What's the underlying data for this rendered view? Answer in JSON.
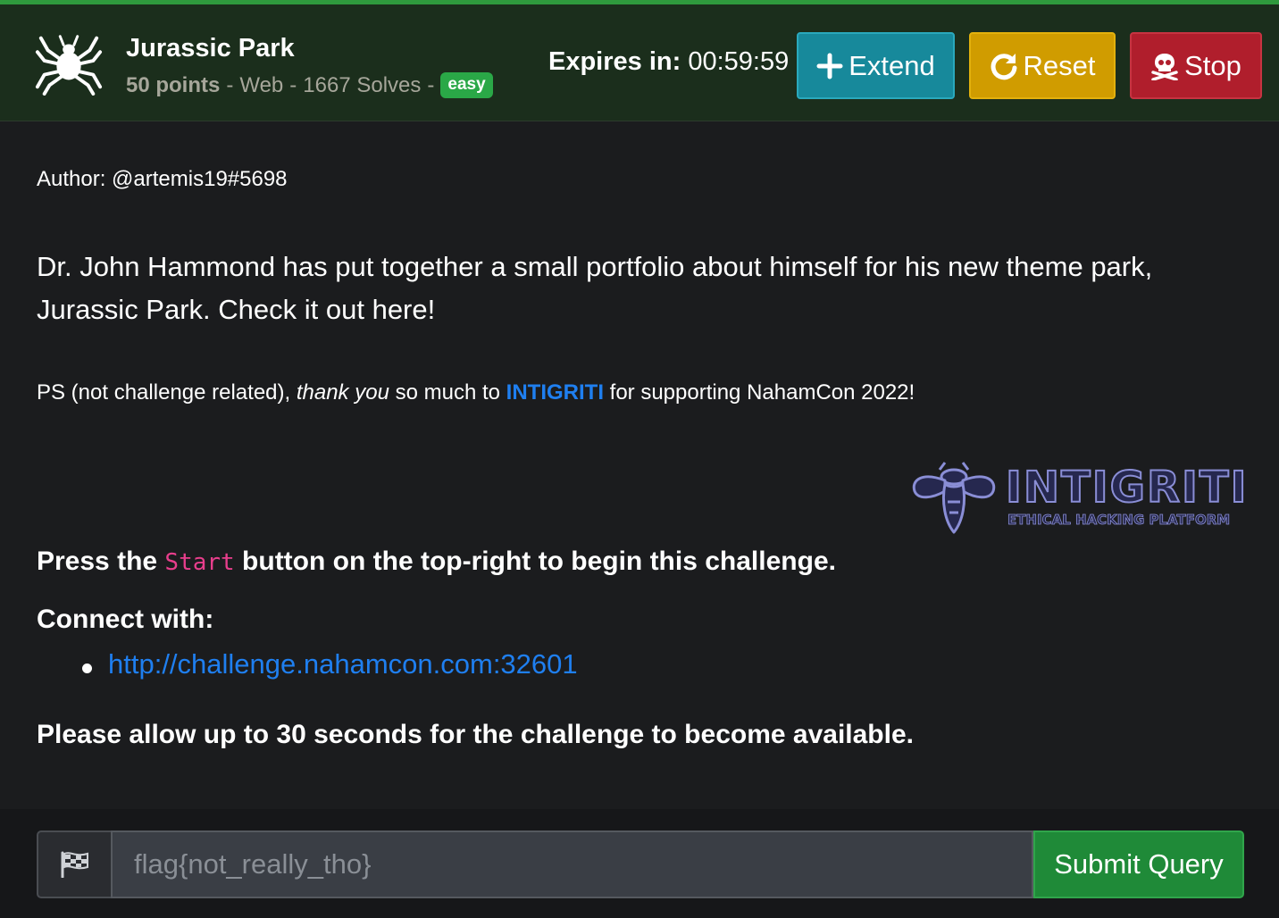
{
  "header": {
    "icon": "spider-icon",
    "title": "Jurassic Park",
    "points": "50 points",
    "category": "Web",
    "solves": "1667 Solves",
    "separator": "-",
    "difficulty": "easy",
    "expires_label": "Expires in",
    "expires_colon": ":",
    "expires_value": "00:59:59",
    "buttons": {
      "extend": {
        "label": "Extend",
        "icon": "plus-icon"
      },
      "reset": {
        "label": "Reset",
        "icon": "redo-icon"
      },
      "stop": {
        "label": "Stop",
        "icon": "skull-crossbones-icon"
      }
    }
  },
  "body": {
    "author": "Author: @artemis19#5698",
    "description": "Dr. John Hammond has put together a small portfolio about himself for his new theme park, Jurassic Park. Check it out here!",
    "ps": {
      "prefix": "PS (not challenge related), ",
      "emphasis": "thank you",
      "middle": " so much to ",
      "brand": "INTIGRITI",
      "suffix": " for supporting NahamCon 2022!"
    },
    "sponsor_logo": {
      "wordmark": "INTIGRITI",
      "tagline": "ETHICAL HACKING PLATFORM"
    },
    "press": {
      "before": "Press the ",
      "code": "Start",
      "after": " button on the top-right to begin this challenge."
    },
    "connect_heading": "Connect with:",
    "connect_links": [
      "http://challenge.nahamcon.com:32601"
    ],
    "allow_note": "Please allow up to 30 seconds for the challenge to become available."
  },
  "flag_form": {
    "icon": "checkered-flag-icon",
    "input_value": "",
    "placeholder": "flag{not_really_tho}",
    "submit_label": "Submit Query"
  },
  "colors": {
    "header_bg": "#1b2e1c",
    "header_accent": "#2f9a3d",
    "page_bg": "#1b1c1e",
    "extend": "#17899b",
    "reset": "#d09c00",
    "stop": "#b01e2c",
    "submit": "#1f8a38",
    "link": "#1f7ff0",
    "badge_easy": "#2aa847",
    "code": "#e83e8c"
  }
}
